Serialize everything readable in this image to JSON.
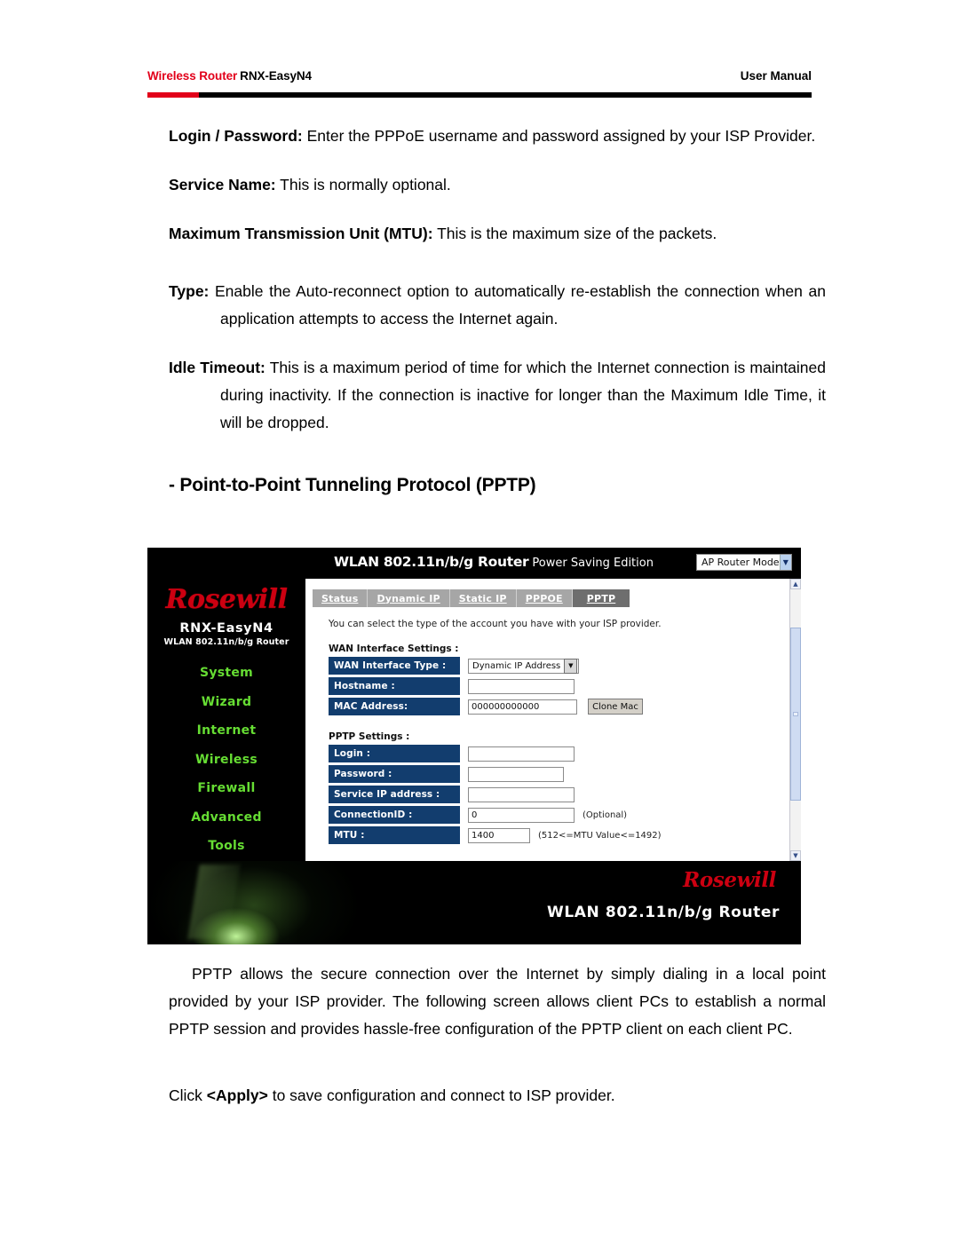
{
  "header": {
    "brand": "Wireless Router",
    "model": "RNX-EasyN4",
    "doc_type": "User Manual",
    "rule_red": "#e2001a",
    "rule_black": "#000000"
  },
  "body_text": {
    "p1_label": "Login / Password:",
    "p1_text": " Enter the PPPoE username and password assigned by your ISP Provider.",
    "p2_label": "Service Name:",
    "p2_text": " This is normally optional.",
    "p3_label": "Maximum Transmission Unit (MTU):",
    "p3_text": " This is the maximum size of the packets.",
    "p4_label": "Type:",
    "p4_text": " Enable the Auto-reconnect option to automatically re-establish the connection when an application attempts to access the Internet again.",
    "p5_label": "Idle Timeout:",
    "p5_text": " This is a maximum period of time for which the Internet connection is maintained during inactivity. If the connection is inactive for longer than the Maximum Idle Time, it will be dropped.",
    "section_heading": "- Point-to-Point Tunneling Protocol (PPTP)",
    "p6_text": "PPTP allows the secure connection over the Internet by simply dialing in a local point provided by your ISP provider. The following screen allows client PCs to establish a normal PPTP session and provides hassle-free configuration of the PPTP client on each client PC.",
    "p7_prefix": "Click ",
    "p7_bold": "<Apply>",
    "p7_suffix": " to save configuration and connect to ISP provider."
  },
  "router_ui": {
    "topbar": {
      "title_main": "WLAN 802.11n/b/g Router",
      "title_sub": "Power Saving Edition",
      "mode_value": "AP Router Mode",
      "mode_arrow": "chevron-down-icon"
    },
    "sidebar": {
      "logo": "Rosewill",
      "model": "RNX-EasyN4",
      "model_sub": "WLAN 802.11n/b/g Router",
      "menu_color": "#66dd33",
      "items": [
        {
          "label": "System"
        },
        {
          "label": "Wizard"
        },
        {
          "label": "Internet"
        },
        {
          "label": "Wireless"
        },
        {
          "label": "Firewall"
        },
        {
          "label": "Advanced"
        },
        {
          "label": "Tools"
        }
      ]
    },
    "tabs": [
      {
        "label": "Status",
        "active": false
      },
      {
        "label": "Dynamic IP",
        "active": false
      },
      {
        "label": "Static IP",
        "active": false
      },
      {
        "label": "PPPOE",
        "active": false
      },
      {
        "label": "PPTP",
        "active": true
      }
    ],
    "intro": "You can select the type of the account you have with your ISP provider.",
    "wan_group_title": "WAN Interface Settings :",
    "wan_rows": [
      {
        "label": "WAN Interface Type :",
        "control": "select",
        "value": "Dynamic IP Address"
      },
      {
        "label": "Hostname :",
        "control": "text",
        "value": ""
      },
      {
        "label": "MAC Address:",
        "control": "text",
        "value": "000000000000",
        "button": "Clone Mac"
      }
    ],
    "pptp_group_title": "PPTP Settings :",
    "pptp_rows": [
      {
        "label": "Login :",
        "control": "text",
        "value": ""
      },
      {
        "label": "Password :",
        "control": "text",
        "value": ""
      },
      {
        "label": "Service IP address :",
        "control": "text",
        "value": ""
      },
      {
        "label": "ConnectionID :",
        "control": "text",
        "value": "0",
        "hint": "(Optional)"
      },
      {
        "label": "MTU :",
        "control": "text",
        "value": "1400",
        "hint": "(512<=MTU Value<=1492)"
      }
    ],
    "scrollbar": {
      "up_arrow": "chevron-up-icon",
      "down_arrow": "chevron-down-icon"
    },
    "banner": {
      "logo": "Rosewill",
      "text": "WLAN 802.11n/b/g Router"
    }
  }
}
